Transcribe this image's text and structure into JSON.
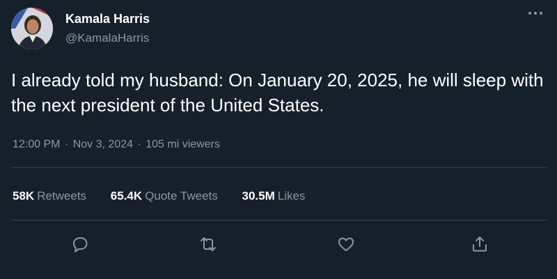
{
  "author": {
    "display_name": "Kamala Harris",
    "handle": "@KamalaHarris"
  },
  "tweet": {
    "text": "I already told my husband: On January 20, 2025, he will sleep with the next president of the United States.",
    "time": "12:00 PM",
    "date": "Nov 3, 2024",
    "views": "105 mi viewers",
    "separator": "·"
  },
  "stats": {
    "retweets_count": "58K",
    "retweets_label": "Retweets",
    "quotes_count": "65.4K",
    "quotes_label": "Quote Tweets",
    "likes_count": "30.5M",
    "likes_label": "Likes"
  },
  "icons": {
    "more": "more-horizontal-icon",
    "reply": "reply-icon",
    "retweet": "retweet-icon",
    "like": "heart-icon",
    "share": "share-icon"
  },
  "colors": {
    "background": "#15202b",
    "text_primary": "#ffffff",
    "text_secondary": "#8b98a5",
    "divider": "#38444d"
  }
}
